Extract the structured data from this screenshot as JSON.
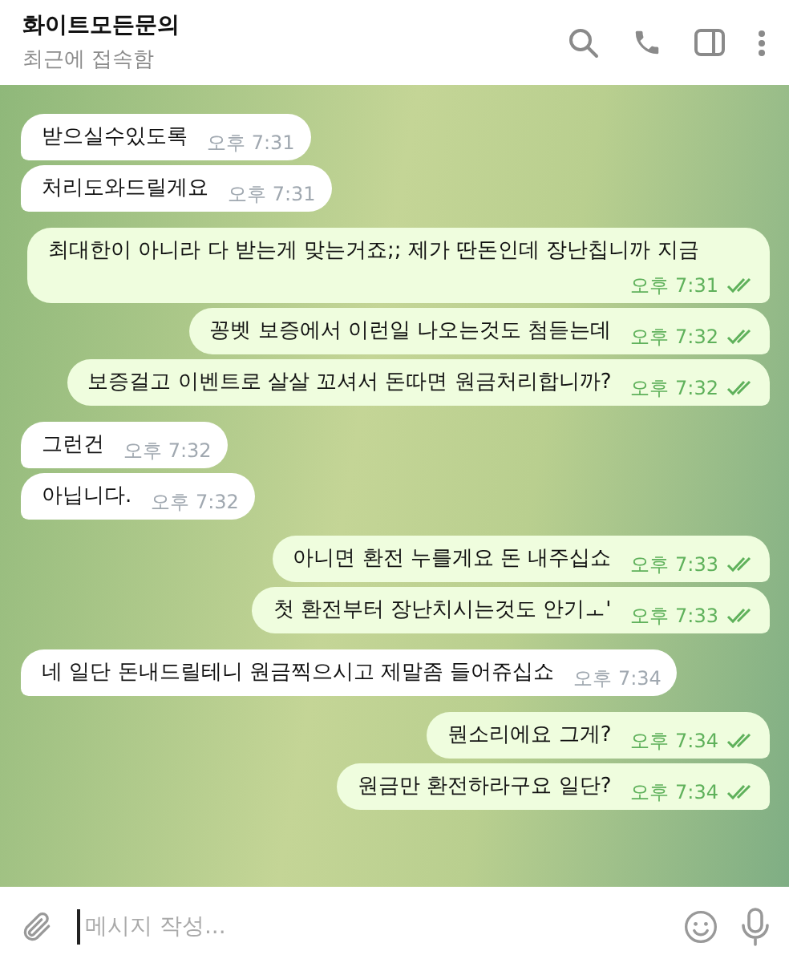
{
  "header": {
    "title": "화이트모든문의",
    "status": "최근에 접속함"
  },
  "messages": [
    {
      "kind": "in",
      "text": "받으실수있도록",
      "time": "오후 7:31"
    },
    {
      "kind": "in",
      "text": "처리도와드릴게요",
      "time": "오후 7:31"
    },
    {
      "kind": "out",
      "text": "최대한이 아니라 다 받는게 맞는거죠;; 제가 딴돈인데 장난칩니까 지금",
      "time": "오후 7:31",
      "read": true
    },
    {
      "kind": "out",
      "text": "꽁벳 보증에서 이런일 나오는것도 첨듣는데",
      "time": "오후 7:32",
      "read": true
    },
    {
      "kind": "out",
      "text": "보증걸고 이벤트로 살살 꼬셔서 돈따면 원금처리합니까?",
      "time": "오후 7:32",
      "read": true
    },
    {
      "kind": "in",
      "text": "그런건",
      "time": "오후 7:32"
    },
    {
      "kind": "in",
      "text": "아닙니다.",
      "time": "오후 7:32"
    },
    {
      "kind": "out",
      "text": "아니면 환전 누를게요 돈 내주십쇼",
      "time": "오후 7:33",
      "read": true
    },
    {
      "kind": "out",
      "text": "첫 환전부터 장난치시는것도 안기ㅗ'",
      "time": "오후 7:33",
      "read": true
    },
    {
      "kind": "in",
      "text": "네 일단 돈내드릴테니 원금찍으시고 제말좀 들어쥬십쇼",
      "time": "오후 7:34"
    },
    {
      "kind": "out",
      "text": "뭔소리에요 그게?",
      "time": "오후 7:34",
      "read": true
    },
    {
      "kind": "out",
      "text": "원금만 환전하라구요 일단?",
      "time": "오후 7:34",
      "read": true
    }
  ],
  "composer": {
    "placeholder": "메시지 작성..."
  }
}
